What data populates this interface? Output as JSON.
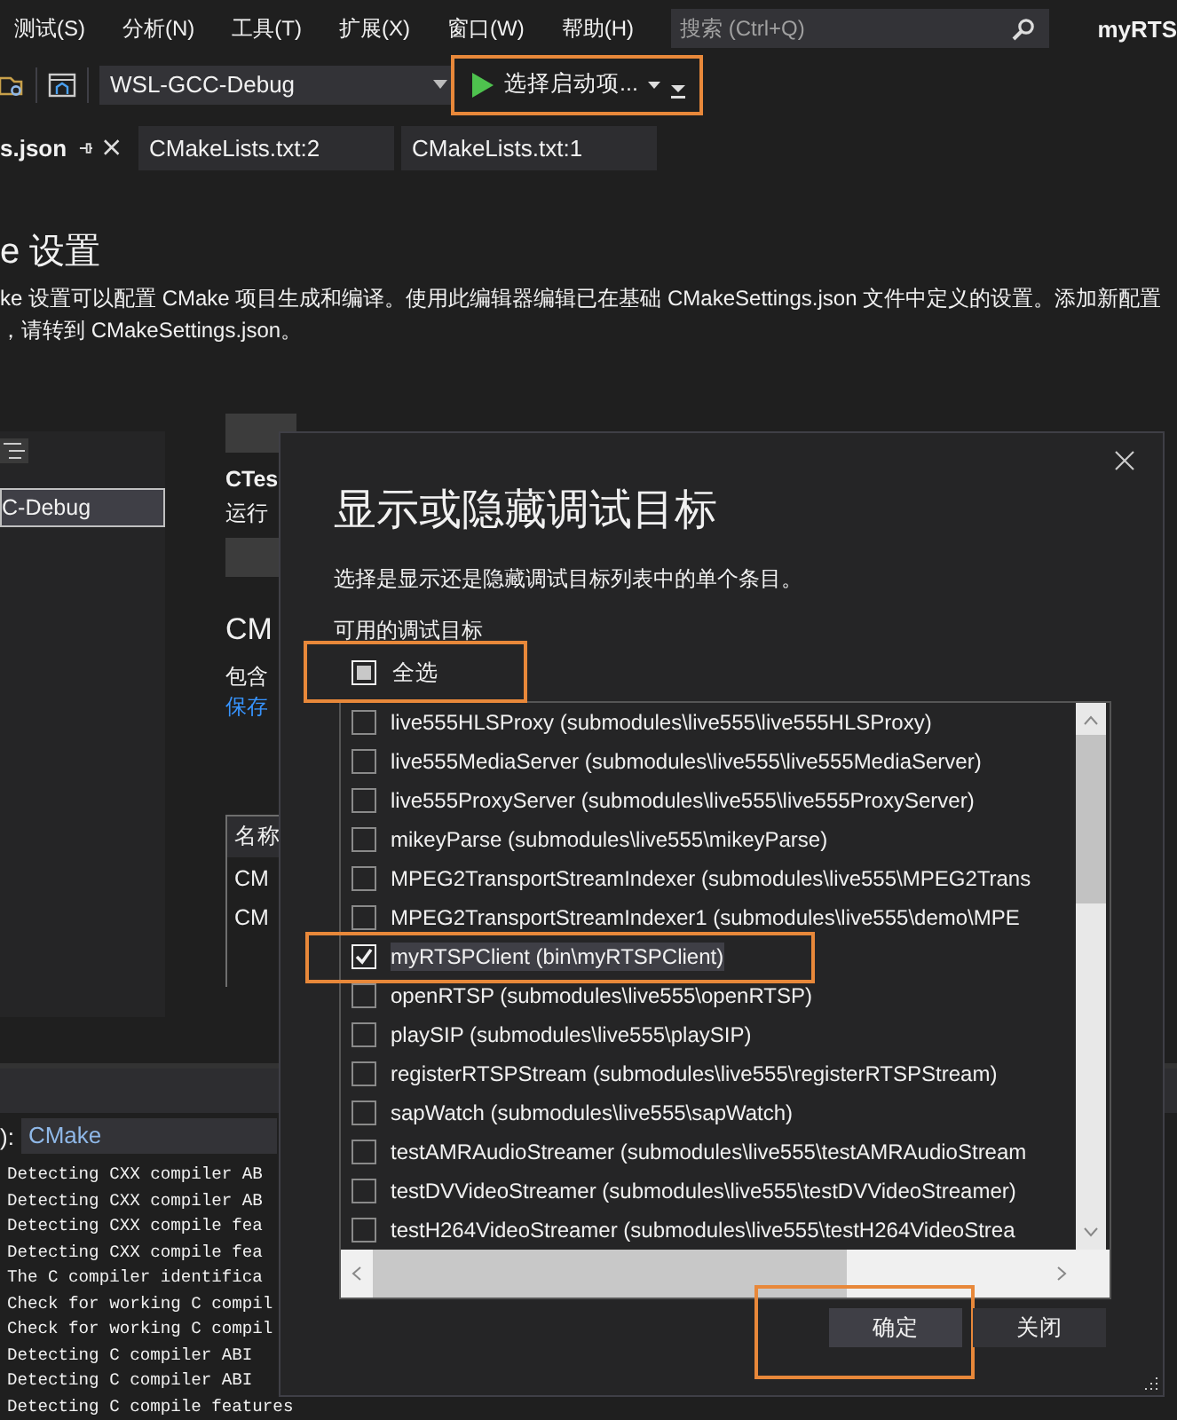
{
  "menu_bar": {
    "items": [
      "测试(S)",
      "分析(N)",
      "工具(T)",
      "扩展(X)",
      "窗口(W)",
      "帮助(H)"
    ],
    "search": {
      "placeholder": "搜索 (Ctrl+Q)"
    },
    "title": "myRTS"
  },
  "toolbar": {
    "configuration": "WSL-GCC-Debug",
    "start_button": {
      "label": "选择启动项...",
      "highlighted": true
    }
  },
  "tabs": [
    {
      "label": "s.json",
      "selected": true
    },
    {
      "label": "CMakeLists.txt:2",
      "selected": false
    },
    {
      "label": "CMakeLists.txt:1",
      "selected": false
    }
  ],
  "settings": {
    "title": "e 设置",
    "description": [
      "ke 设置可以配置 CMake 项目生成和编译。使用此编辑器编辑已在基础 CMakeSettings.json 文件中定义的设置。添加新配置",
      "，请转到 CMakeSettings.json。"
    ],
    "configurations": [
      {
        "label": "C-Debug",
        "selected": true
      }
    ],
    "ctest": {
      "title": "CTes",
      "text": "运行"
    },
    "cmake": {
      "title": "CM",
      "text": "包含",
      "link": "保存"
    },
    "table": {
      "columns": [
        "名称"
      ],
      "rows": [
        "CM",
        "CM"
      ]
    }
  },
  "output": {
    "source_label": "):",
    "source": "CMake",
    "lines": [
      "Detecting CXX compiler AB",
      "Detecting CXX compiler AB",
      "Detecting CXX compile fea",
      "Detecting CXX compile fea",
      "The C compiler identifica",
      "Check for working C compil",
      "Check for working C compil",
      "Detecting C compiler ABI",
      "Detecting C compiler ABI",
      "Detecting C compile features"
    ]
  },
  "dialog": {
    "title": "显示或隐藏调试目标",
    "subtitle": "选择是显示还是隐藏调试目标列表中的单个条目。",
    "list_label": "可用的调试目标",
    "select_all": {
      "label": "全选",
      "checked": false,
      "mixed": true,
      "highlighted": true
    },
    "items": [
      {
        "label": "live555HLSProxy (submodules\\live555\\live555HLSProxy)",
        "checked": false,
        "highlighted": false
      },
      {
        "label": "live555MediaServer (submodules\\live555\\live555MediaServer)",
        "checked": false,
        "highlighted": false
      },
      {
        "label": "live555ProxyServer (submodules\\live555\\live555ProxyServer)",
        "checked": false,
        "highlighted": false
      },
      {
        "label": "mikeyParse (submodules\\live555\\mikeyParse)",
        "checked": false,
        "highlighted": false
      },
      {
        "label": "MPEG2TransportStreamIndexer (submodules\\live555\\MPEG2Trans",
        "checked": false,
        "highlighted": false
      },
      {
        "label": "MPEG2TransportStreamIndexer1 (submodules\\live555\\demo\\MPE",
        "checked": false,
        "highlighted": false
      },
      {
        "label": "myRTSPClient (bin\\myRTSPClient)",
        "checked": true,
        "highlighted": true
      },
      {
        "label": "openRTSP (submodules\\live555\\openRTSP)",
        "checked": false,
        "highlighted": false
      },
      {
        "label": "playSIP (submodules\\live555\\playSIP)",
        "checked": false,
        "highlighted": false
      },
      {
        "label": "registerRTSPStream (submodules\\live555\\registerRTSPStream)",
        "checked": false,
        "highlighted": false
      },
      {
        "label": "sapWatch (submodules\\live555\\sapWatch)",
        "checked": false,
        "highlighted": false
      },
      {
        "label": "testAMRAudioStreamer (submodules\\live555\\testAMRAudioStream",
        "checked": false,
        "highlighted": false
      },
      {
        "label": "testDVVideoStreamer (submodules\\live555\\testDVVideoStreamer)",
        "checked": false,
        "highlighted": false
      },
      {
        "label": "testH264VideoStreamer (submodules\\live555\\testH264VideoStrea",
        "checked": false,
        "highlighted": false
      }
    ],
    "buttons": [
      {
        "label": "确定",
        "highlighted": true
      },
      {
        "label": "关闭",
        "highlighted": false
      }
    ]
  }
}
